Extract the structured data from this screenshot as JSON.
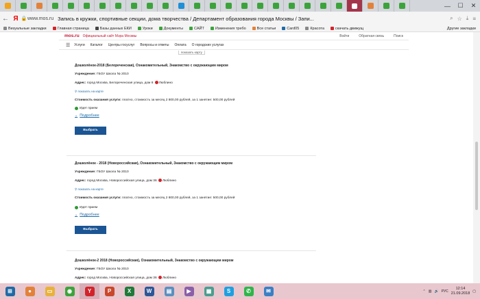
{
  "tabs": [
    {
      "color": "#f2a41b"
    },
    {
      "color": "#3ca33c"
    },
    {
      "color": "#e2823a"
    },
    {
      "color": "#3ca33c"
    },
    {
      "color": "#3ca33c"
    },
    {
      "color": "#3ca33c"
    },
    {
      "color": "#3ca33c"
    },
    {
      "color": "#3ca33c"
    },
    {
      "color": "#3ca33c"
    },
    {
      "color": "#3ca33c"
    },
    {
      "color": "#3ca33c"
    },
    {
      "color": "#1f8fd6"
    },
    {
      "color": "#3ca33c"
    },
    {
      "color": "#3ca33c"
    },
    {
      "color": "#3ca33c"
    },
    {
      "color": "#3ca33c"
    },
    {
      "color": "#3ca33c"
    },
    {
      "color": "#3ca33c"
    },
    {
      "color": "#3ca33c"
    },
    {
      "color": "#3ca33c"
    },
    {
      "color": "#3ca33c"
    },
    {
      "color": "#3ca33c"
    },
    {
      "color": "#c8102e"
    },
    {
      "color": "#e2823a"
    },
    {
      "color": "#3ca33c"
    },
    {
      "color": "#3ca33c"
    }
  ],
  "active_tab_index": 22,
  "browser": {
    "url": "www.mos.ru",
    "page_title": "Запись в кружки, спортивные секции, дома творчества / Департамент образования города Москвы / Запи..."
  },
  "bookmarks": {
    "items": [
      {
        "label": "Визуальные закладки",
        "color": "#888888"
      },
      {
        "label": "Главная страница",
        "color": "#d2232a"
      },
      {
        "label": "Базы данных ЕКИ",
        "color": "#444444"
      },
      {
        "label": "Уроки",
        "color": "#3ca33c"
      },
      {
        "label": "Документы",
        "color": "#3ca33c"
      },
      {
        "label": "САЙТ",
        "color": "#3ca33c"
      },
      {
        "label": "Изменения требо",
        "color": "#3ca33c"
      },
      {
        "label": "Все статьи",
        "color": "#e2823a"
      },
      {
        "label": "Card05",
        "color": "#1f6aa5"
      },
      {
        "label": "Красота",
        "color": "#888888"
      },
      {
        "label": "скачать движущ",
        "color": "#d2232a"
      }
    ],
    "other_label": "Другие закладки"
  },
  "site": {
    "logo": "mos.ru",
    "tagline": "Официальный сайт Мэра Москвы",
    "links": [
      "Войти",
      "Обратная связь",
      "Поиск"
    ],
    "nav": [
      "Услуги",
      "Каталог",
      "Центры госуслуг",
      "Вопросы и ответы",
      "Оплата",
      "О городских услугах"
    ]
  },
  "top_map_link": "показать карту",
  "cards": [
    {
      "title": "Дошколёнок-2018 (Белореченская), Ознакомительный, Знакомство с окружающим миром",
      "org_label": "Учреждение:",
      "org": "ГБОУ Школа № 2010",
      "addr_label": "Адрес:",
      "addr": "город Москва, Белореченская улица, дом 8",
      "metro": "Люблино",
      "map_link": "показать на карте",
      "cost_label": "Стоимость оказания услуги:",
      "cost": "платно, стоимость за месяц 2 800,00 рублей, за 1 занятие: 500,00 рублей",
      "status": "Идет прием",
      "more": "Подробнее",
      "button": "Выбрать"
    },
    {
      "title": "Дошколёнок - 2018 (Новороссийская), Ознакомительный, Знакомство с окружающим миром",
      "org_label": "Учреждение:",
      "org": "ГБОУ Школа № 2010",
      "addr_label": "Адрес:",
      "addr": "город Москва, Новороссийская улица, дом 36",
      "metro": "Люблино",
      "map_link": "показать на карте",
      "cost_label": "Стоимость оказания услуги:",
      "cost": "платно, стоимость за месяц 2 800,00 рублей, за 1 занятие: 500,00 рублей",
      "status": "Идет прием",
      "more": "Подробнее",
      "button": "Выбрать"
    },
    {
      "title": "Дошколёнок-2 2018 (Новороссийская), Ознакомительный, Знакомство с окружающим миром",
      "org_label": "Учреждение:",
      "org": "ГБОУ Школа № 2010",
      "addr_label": "Адрес:",
      "addr": "город Москва, Новороссийская улица, дом 36",
      "metro": "Люблино"
    }
  ],
  "taskbar": {
    "apps": [
      {
        "name": "start-button",
        "glyph": "⊞",
        "color": "#1f6aa5"
      },
      {
        "name": "firefox-app",
        "glyph": "●",
        "color": "#e2823a"
      },
      {
        "name": "explorer-app",
        "glyph": "▭",
        "color": "#e8b23a"
      },
      {
        "name": "chrome-app",
        "glyph": "◉",
        "color": "#3ca33c"
      },
      {
        "name": "yandex-browser-app",
        "glyph": "Y",
        "color": "#d2232a"
      },
      {
        "name": "powerpoint-app",
        "glyph": "P",
        "color": "#c9472b"
      },
      {
        "name": "excel-app",
        "glyph": "X",
        "color": "#1f7a3a"
      },
      {
        "name": "word-app",
        "glyph": "W",
        "color": "#2b5797"
      },
      {
        "name": "notepad-app",
        "glyph": "▤",
        "color": "#5a8fc0"
      },
      {
        "name": "media-app",
        "glyph": "▶",
        "color": "#8a5fa8"
      },
      {
        "name": "app-11",
        "glyph": "▦",
        "color": "#4a9d8f"
      },
      {
        "name": "skype-app",
        "glyph": "S",
        "color": "#1ea0e0"
      },
      {
        "name": "whatsapp-app",
        "glyph": "✆",
        "color": "#2fb54a"
      },
      {
        "name": "app-14",
        "glyph": "✉",
        "color": "#3b7fc4"
      }
    ],
    "lang": "РУС",
    "time": "12:14",
    "date": "21.09.2018"
  }
}
